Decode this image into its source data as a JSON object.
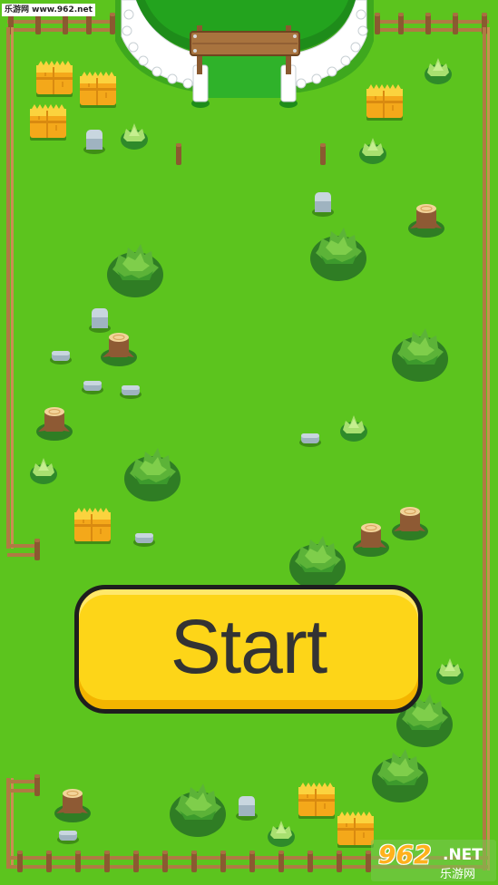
{
  "watermark_top": "乐游网 www.962.net",
  "start_button": {
    "label": "Start"
  },
  "watermark_bottom": {
    "number": "962",
    "suffix": ".NET",
    "name": "乐游网"
  },
  "colors": {
    "grass": "#5cc41e",
    "button_fill": "#fdd518",
    "button_border": "#1e1e1e",
    "button_text": "#333333"
  },
  "scene_items": {
    "hay_bales": 8,
    "bushes": 9,
    "small_shrubs": 7,
    "tree_stumps": 7,
    "rocks": 11,
    "signboard": "blank wooden sign",
    "gate": "stone arch entrance"
  }
}
